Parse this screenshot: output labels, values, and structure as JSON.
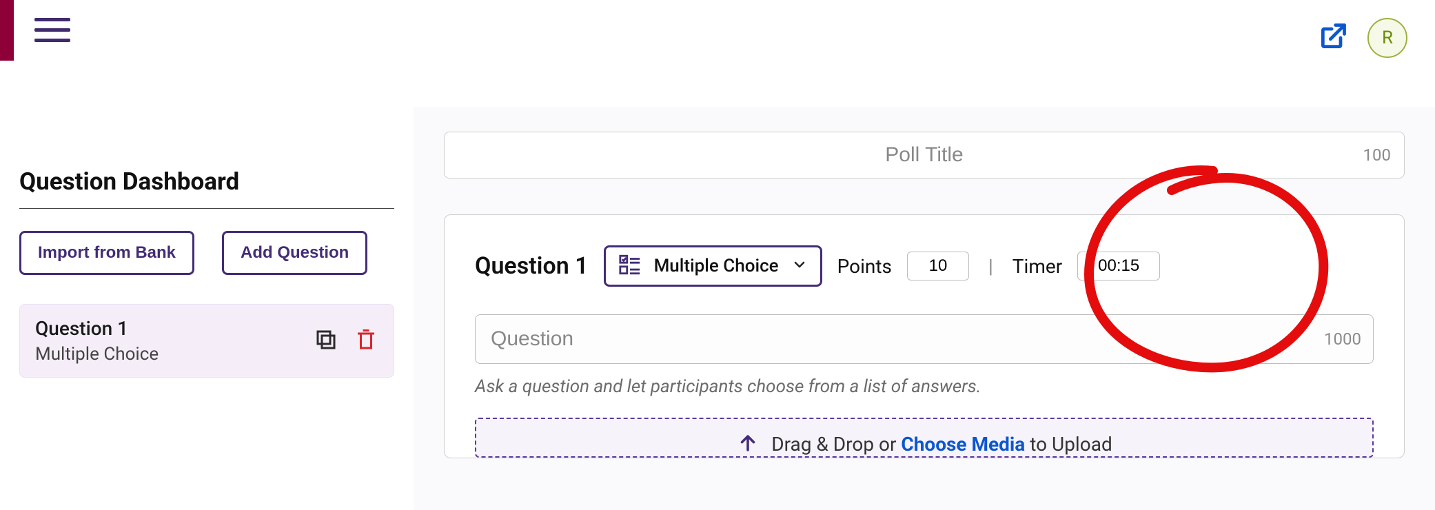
{
  "topbar": {
    "avatar_initial": "R"
  },
  "sidebar": {
    "title": "Question Dashboard",
    "import_button": "Import from Bank",
    "add_button": "Add Question",
    "question_item": {
      "title": "Question 1",
      "type": "Multiple Choice"
    }
  },
  "editor": {
    "poll_title_placeholder": "Poll Title",
    "poll_title_maxlen": "100",
    "question_number_label": "Question 1",
    "question_type": "Multiple Choice",
    "points_label": "Points",
    "points_value": "10",
    "timer_label": "Timer",
    "timer_value": "00:15",
    "question_placeholder": "Question",
    "question_maxlen": "1000",
    "helper_text": "Ask a question and let participants choose from a list of answers.",
    "upload_pre": "Drag & Drop or ",
    "upload_action": "Choose Media",
    "upload_post": " to Upload"
  }
}
